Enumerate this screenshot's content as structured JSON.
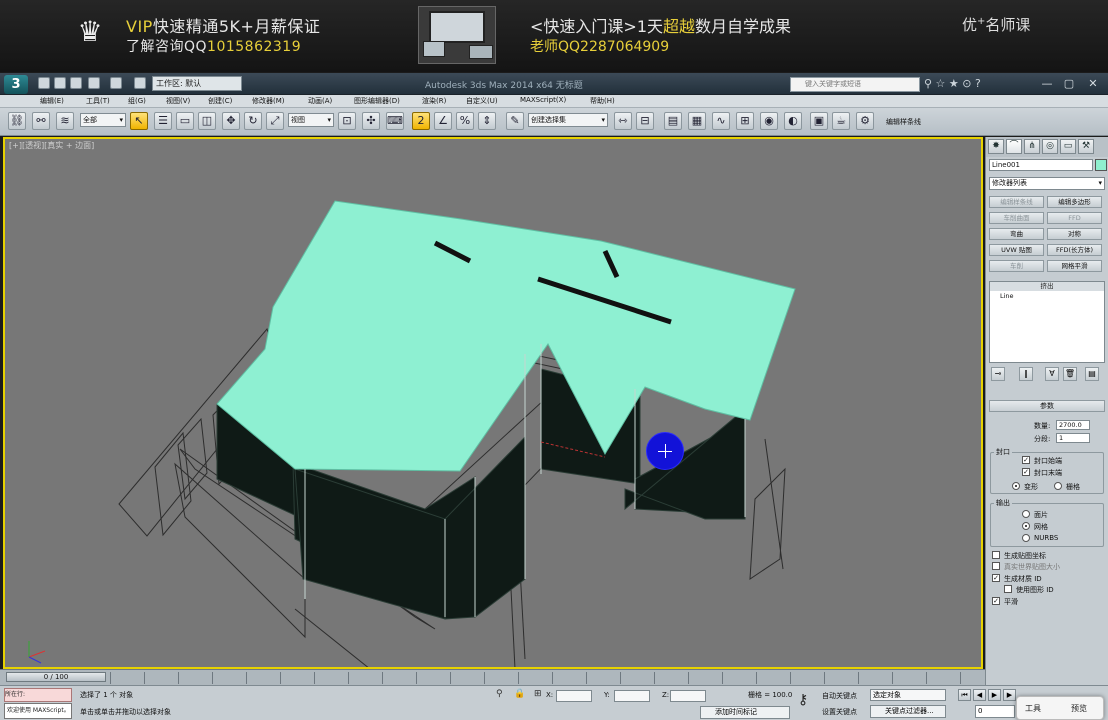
{
  "banner": {
    "vip_label": "VIP",
    "line1_rest": "快速精通5K+月薪保证",
    "line2_prefix": "了解咨询QQ",
    "line2_qq": "1015862319",
    "right_line1_a": "<快速入门课>1天",
    "right_line1_hl": "超越",
    "right_line1_b": "数月自学成果",
    "right_line2_prefix": "老师QQ",
    "right_line2_qq": "2287064909",
    "brand": "优",
    "brand_sup": "+",
    "brand_rest": "名师课",
    "accent_color": "#e7cf3a"
  },
  "titlebar": {
    "app_icon": "3ds-max-logo-icon",
    "workspace": "工作区: 默认",
    "window_title": "Autodesk 3ds Max 2014 x64    无标题",
    "search_placeholder": "键入关键字或短语",
    "window_controls": [
      "minimize-icon",
      "maximize-icon",
      "close-icon"
    ]
  },
  "menu": [
    "编辑(E)",
    "工具(T)",
    "组(G)",
    "视图(V)",
    "创建(C)",
    "修改器(M)",
    "动画(A)",
    "图形编辑器(D)",
    "渲染(R)",
    "自定义(U)",
    "MAXScript(X)",
    "帮助(H)"
  ],
  "toolbar": {
    "selection_filter": "全部",
    "ref_coord": "视图",
    "named_sel": "创建选择集",
    "big_label": "编辑样条线"
  },
  "viewport": {
    "label": "[+][透视][真实 + 边面]",
    "object_color": "#8ef0d2",
    "border_color": "#e7d200"
  },
  "cmdpanel": {
    "tabs": [
      "create-tab",
      "modify-tab",
      "hierarchy-tab",
      "motion-tab",
      "display-tab",
      "utilities-tab"
    ],
    "object_name": "Line001",
    "object_color": "#8ff0cf",
    "modifier_list": "修改器列表",
    "buttons": [
      {
        "label": "编辑样条线",
        "disabled": true
      },
      {
        "label": "编辑多边形",
        "disabled": false
      },
      {
        "label": "车削曲面",
        "disabled": true
      },
      {
        "label": "FFD",
        "disabled": true
      },
      {
        "label": "弯曲",
        "disabled": false
      },
      {
        "label": "对称",
        "disabled": false
      },
      {
        "label": "UVW 贴图",
        "disabled": false
      },
      {
        "label": "FFD(长方体)",
        "disabled": false
      },
      {
        "label": "车削",
        "disabled": true
      },
      {
        "label": "网格平滑",
        "disabled": false
      }
    ],
    "stack_header": "挤出",
    "stack_item": "Line",
    "params_title": "参数",
    "amount_label": "数量:",
    "amount_value": "2700.0",
    "segments_label": "分段:",
    "segments_value": "1",
    "capping_title": "封口",
    "cap_start": "封口始端",
    "cap_end": "封口末端",
    "morph": "变形",
    "grid": "栅格",
    "output_title": "输出",
    "out_patch": "面片",
    "out_mesh": "网格",
    "out_nurbs": "NURBS",
    "gen_map": "生成贴图坐标",
    "real_world": "真实世界贴图大小",
    "gen_mat": "生成材质 ID",
    "use_shape": "使用图形 ID",
    "smooth": "平滑"
  },
  "timeline": {
    "frame": "0 / 100"
  },
  "status": {
    "mini_label": "所在行:",
    "mini_script": "欢迎使用 MAXScript。",
    "msg1": "选择了 1 个 对象",
    "msg2": "单击或单击并拖动以选择对象",
    "x_label": "X:",
    "y_label": "Y:",
    "z_label": "Z:",
    "grid": "栅格 = 100.0",
    "add_time": "添加时间标记",
    "auto_key": "自动关键点",
    "set_key": "设置关键点",
    "sel_object": "选定对象",
    "key_filter": "关键点过滤器...",
    "frame_value": "0",
    "popup_left": "工具",
    "popup_right": "预览"
  }
}
